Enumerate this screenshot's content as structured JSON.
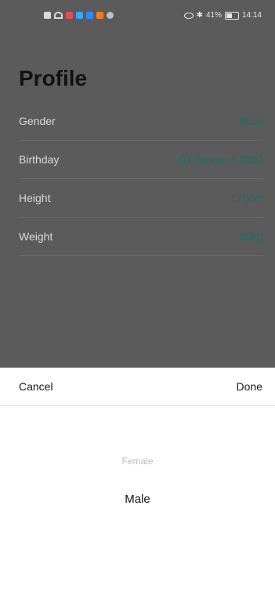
{
  "status_bar": {
    "left_icons": [
      {
        "name": "app-notification-icon",
        "color": "#d9d9d9"
      },
      {
        "name": "wifi-icon",
        "color": "#d9d9d9"
      },
      {
        "name": "app-notification-icon",
        "color": "#e84a5f"
      },
      {
        "name": "app-notification-icon",
        "color": "#3aa7ff"
      },
      {
        "name": "app-notification-icon",
        "color": "#2e8bff"
      },
      {
        "name": "app-notification-icon",
        "color": "#ff7a1a"
      },
      {
        "name": "app-notification-icon",
        "color": "#bfbfbf"
      }
    ],
    "battery_percent": "41%",
    "battery_level": 0.41,
    "time": "14:14"
  },
  "page": {
    "title": "Profile"
  },
  "profile_rows": [
    {
      "label": "Gender",
      "value": "Male"
    },
    {
      "label": "Birthday",
      "value": "01 January, 2002"
    },
    {
      "label": "Height",
      "value": "170cm"
    },
    {
      "label": "Weight",
      "value": "65kg"
    }
  ],
  "sheet": {
    "cancel_label": "Cancel",
    "done_label": "Done",
    "options": [
      "Female",
      "Male"
    ],
    "selected": "Male"
  },
  "colors": {
    "overlay": "#5b5b5b",
    "accent_value": "#1d6d64"
  }
}
